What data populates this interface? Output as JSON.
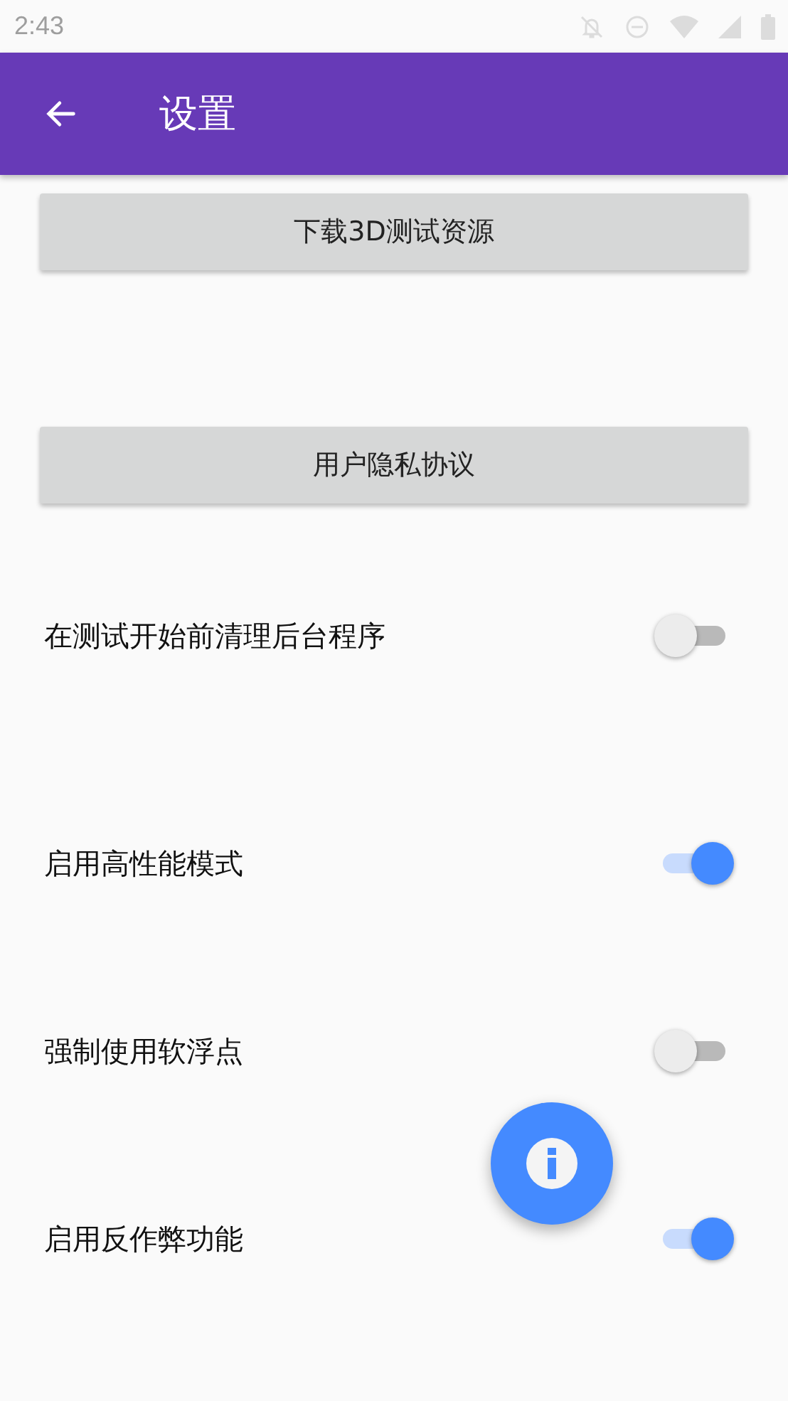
{
  "status_bar": {
    "time": "2:43"
  },
  "app_bar": {
    "title": "设置"
  },
  "buttons": [
    "下载3D测试资源",
    "用户隐私协议"
  ],
  "settings": [
    {
      "label": "在测试开始前清理后台程序",
      "on": false
    },
    {
      "label": "启用高性能模式",
      "on": true
    },
    {
      "label": "强制使用软浮点",
      "on": false
    },
    {
      "label": "启用反作弊功能",
      "on": true
    }
  ]
}
